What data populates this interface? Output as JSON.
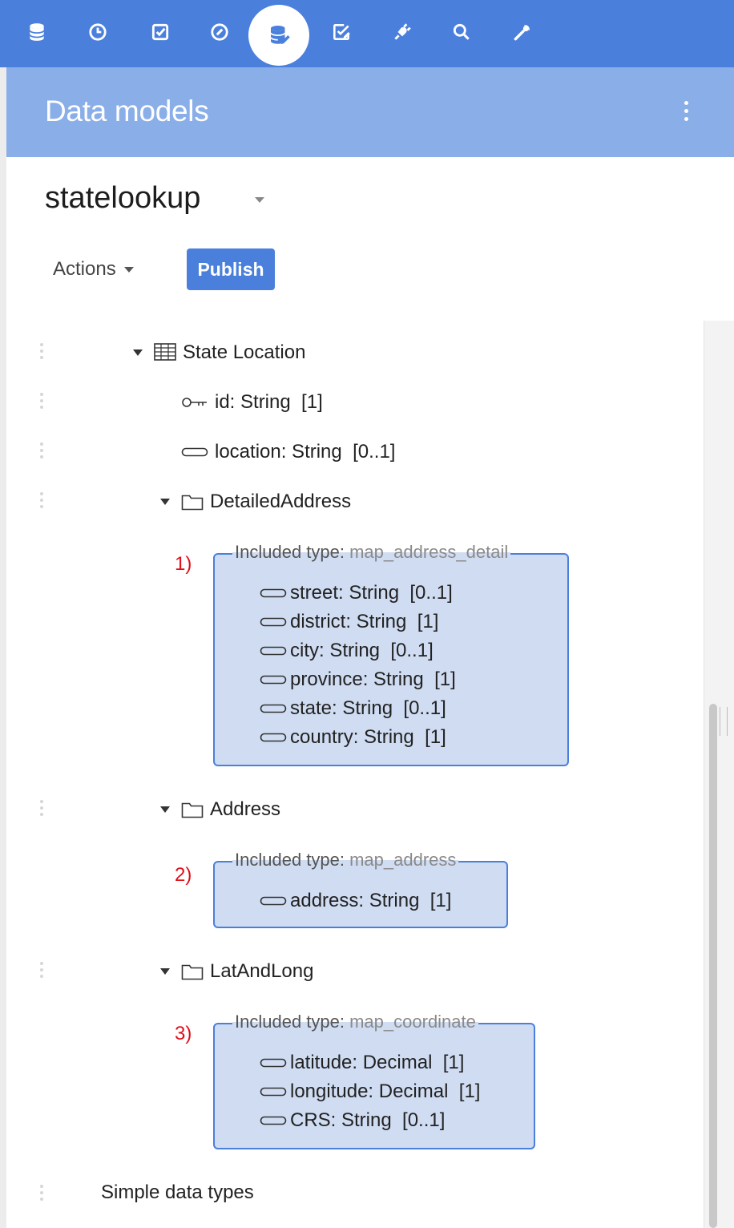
{
  "toolbar": {
    "icons": [
      "database-icon",
      "clock-icon",
      "checkbox-icon",
      "gauge-icon",
      "data-models-icon",
      "task-edit-icon",
      "plug-icon",
      "search-icon",
      "wrench-icon"
    ],
    "active": "data-models-icon",
    "accent": "#4a80dc"
  },
  "header": {
    "title": "Data models"
  },
  "model": {
    "name": "statelookup"
  },
  "actions": {
    "actions_label": "Actions",
    "publish_label": "Publish"
  },
  "tree": {
    "entity": {
      "label": "State Location"
    },
    "fields": [
      {
        "label": "id: String  [1]",
        "icon": "key-icon"
      },
      {
        "label": "location: String  [0..1]",
        "icon": "field-icon"
      }
    ],
    "groups": [
      {
        "label": "DetailedAddress",
        "marker": "1)",
        "included_prefix": "Included type:",
        "included_type": "map_address_detail",
        "fields": [
          "street: String  [0..1]",
          "district: String  [1]",
          "city: String  [0..1]",
          "province: String  [1]",
          "state: String  [0..1]",
          "country: String  [1]"
        ]
      },
      {
        "label": "Address",
        "marker": "2)",
        "included_prefix": "Included type:",
        "included_type": "map_address",
        "fields": [
          "address: String  [1]"
        ]
      },
      {
        "label": "LatAndLong",
        "marker": "3)",
        "included_prefix": "Included type:",
        "included_type": "map_coordinate",
        "fields": [
          "latitude: Decimal  [1]",
          "longitude: Decimal  [1]",
          "CRS: String  [0..1]"
        ]
      }
    ],
    "simple_types": "Simple data types"
  }
}
